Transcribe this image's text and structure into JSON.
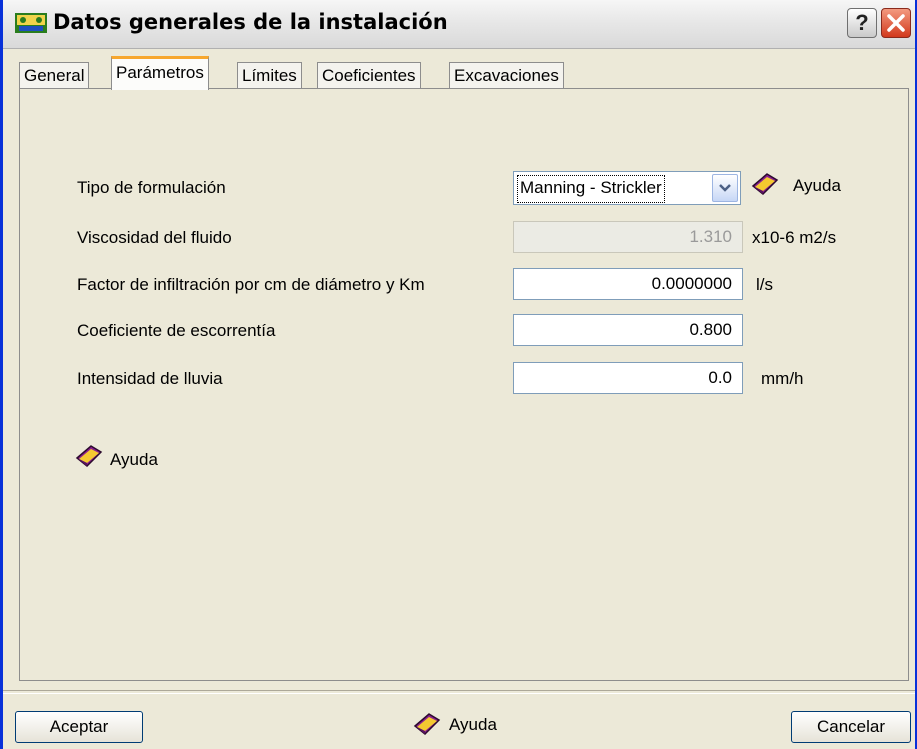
{
  "window": {
    "title": "Datos generales de la instalación",
    "help_glyph": "?"
  },
  "tabs": [
    {
      "label": "General"
    },
    {
      "label": "Parámetros"
    },
    {
      "label": "Límites"
    },
    {
      "label": "Coeficientes"
    },
    {
      "label": "Excavaciones"
    }
  ],
  "form": {
    "formulation_label": "Tipo de formulación",
    "formulation_value": "Manning - Strickler",
    "viscosity_label": "Viscosidad del fluido",
    "viscosity_value": "1.310",
    "viscosity_unit": "x10-6 m2/s",
    "infiltration_label": "Factor de infiltración por cm de diámetro y Km",
    "infiltration_value": "0.0000000",
    "infiltration_unit": "l/s",
    "runoff_label": "Coeficiente de escorrentía",
    "runoff_value": "0.800",
    "rain_label": "Intensidad de lluvia",
    "rain_value": "0.0",
    "rain_unit": "mm/h"
  },
  "help": {
    "label": "Ayuda"
  },
  "footer": {
    "accept": "Aceptar",
    "cancel": "Cancelar",
    "help": "Ayuda"
  },
  "icons": [
    "app-icon",
    "help-icon",
    "close-icon",
    "chevron-down-icon",
    "help-book-icon"
  ],
  "colors": {
    "accent_tab": "#f7a72d",
    "close_red": "#d2391c",
    "frame_blue": "#0831d9"
  }
}
